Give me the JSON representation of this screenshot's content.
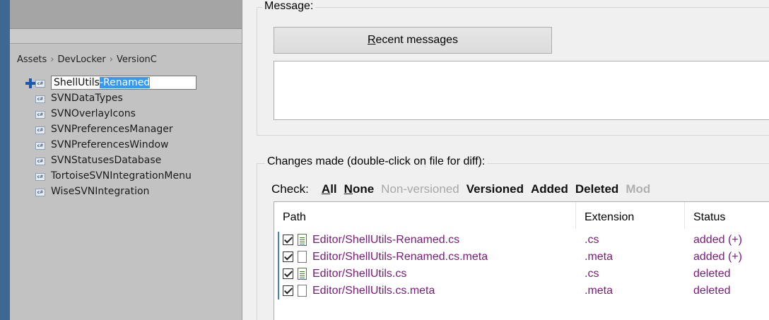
{
  "unity": {
    "breadcrumb": [
      "Assets",
      "DevLocker",
      "VersionC"
    ],
    "breadcrumb_sep": "›",
    "renaming": {
      "prefix": "ShellUtils",
      "selected": "-Renamed"
    },
    "icon_label": "c#",
    "items": [
      "SVNDataTypes",
      "SVNOverlayIcons",
      "SVNPreferencesManager",
      "SVNPreferencesWindow",
      "SVNStatusesDatabase",
      "TortoiseSVNIntegrationMenu",
      "WiseSVNIntegration"
    ]
  },
  "dialog": {
    "message_label": "Message:",
    "recent_messages": {
      "mnemonic": "R",
      "rest": "ecent messages"
    },
    "changes_label": "Changes made (double-click on file for diff):",
    "check_label": "Check:",
    "check_links": {
      "all": {
        "mnemonic": "A",
        "rest": "ll"
      },
      "none": {
        "mnemonic": "N",
        "rest": "one"
      },
      "nonversioned": "Non-versioned",
      "versioned": "Versioned",
      "added": "Added",
      "deleted": "Deleted",
      "modified": "Mod"
    },
    "columns": {
      "path": "Path",
      "extension": "Extension",
      "status": "Status"
    },
    "files": [
      {
        "path": "Editor/ShellUtils-Renamed.cs",
        "ext": ".cs",
        "status": "added (+)",
        "icon": "cs-file-icon"
      },
      {
        "path": "Editor/ShellUtils-Renamed.cs.meta",
        "ext": ".meta",
        "status": "added (+)",
        "icon": "file-icon"
      },
      {
        "path": "Editor/ShellUtils.cs",
        "ext": ".cs",
        "status": "deleted",
        "icon": "cs-file-icon"
      },
      {
        "path": "Editor/ShellUtils.cs.meta",
        "ext": ".meta",
        "status": "deleted",
        "icon": "file-icon"
      }
    ]
  }
}
